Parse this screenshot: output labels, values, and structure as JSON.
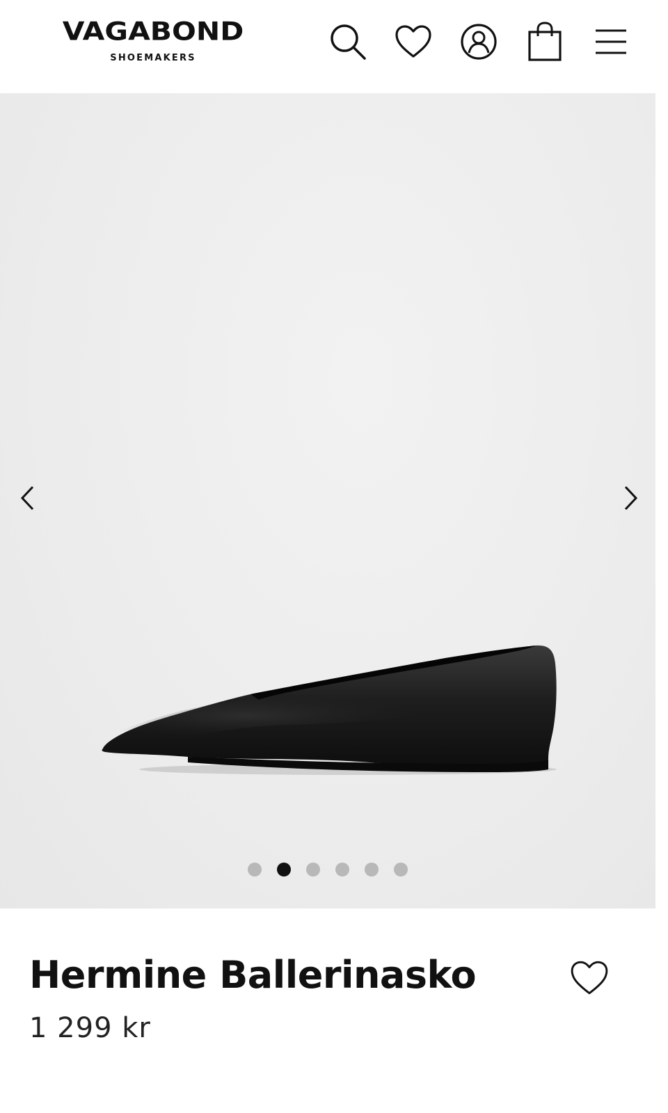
{
  "header": {
    "brand_name": "VAGABOND",
    "brand_tagline": "SHOEMAKERS",
    "icons": [
      "search-icon",
      "heart-icon",
      "account-icon",
      "shopping-bag-icon",
      "menu-icon"
    ]
  },
  "gallery": {
    "image_count": 6,
    "active_index": 1,
    "prev_icon": "chevron-left-icon",
    "next_icon": "chevron-right-icon"
  },
  "product": {
    "name": "Hermine Ballerinasko",
    "price": "1 299 kr",
    "favorite_icon": "heart-outline-icon"
  },
  "colors": {
    "text": "#111111",
    "background": "#ffffff",
    "gallery_bg": "#ececec",
    "dot_inactive": "#b8b8b8",
    "dot_active": "#111111"
  }
}
